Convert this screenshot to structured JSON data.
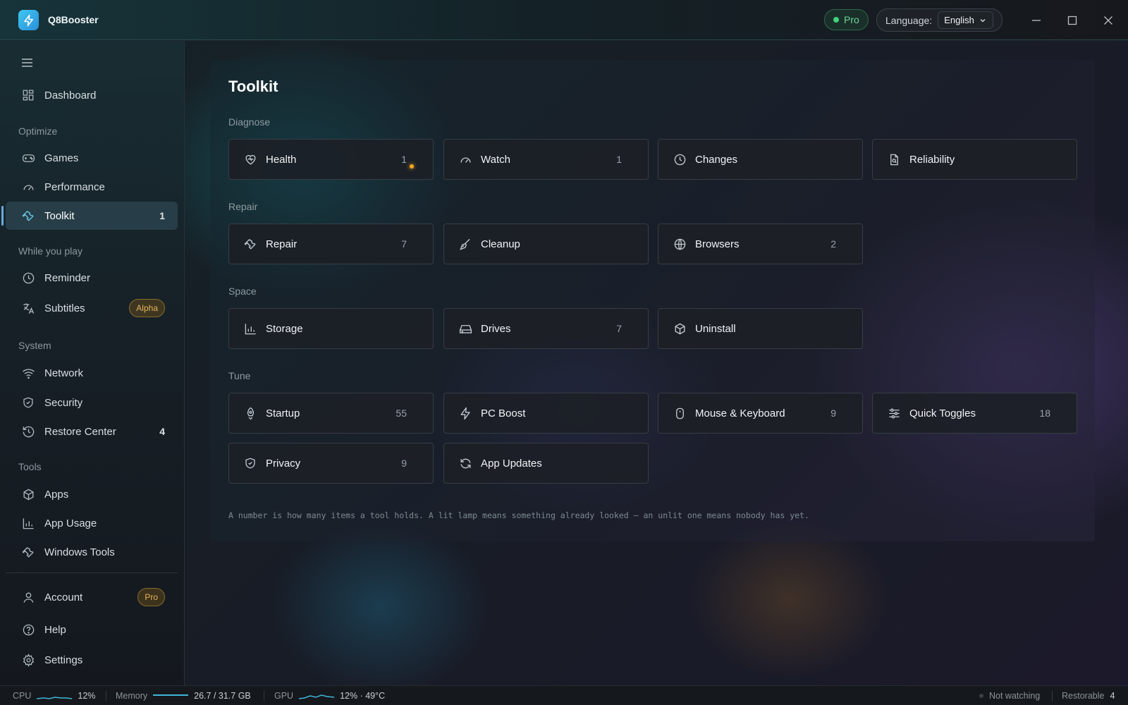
{
  "window": {
    "title": "Q8Booster",
    "pro_label": "Pro",
    "language_label": "Language:",
    "language_value": "English"
  },
  "sidebar": {
    "items": [
      {
        "label": "Dashboard",
        "icon": "dashboard-icon"
      },
      {
        "label": "Games",
        "icon": "gamepad-icon"
      },
      {
        "label": "Performance",
        "icon": "gauge-icon"
      },
      {
        "label": "Toolkit",
        "icon": "wrench-icon",
        "count": "1",
        "active": true
      },
      {
        "label": "Reminder",
        "icon": "clock-icon"
      },
      {
        "label": "Subtitles",
        "icon": "translate-icon",
        "badge": "Alpha"
      },
      {
        "label": "Network",
        "icon": "wifi-icon"
      },
      {
        "label": "Security",
        "icon": "shield-icon"
      },
      {
        "label": "Restore Center",
        "icon": "history-icon",
        "count": "4"
      },
      {
        "label": "Apps",
        "icon": "package-icon"
      },
      {
        "label": "App Usage",
        "icon": "bar-chart-icon"
      },
      {
        "label": "Windows Tools",
        "icon": "wrench-icon"
      },
      {
        "label": "Account",
        "icon": "user-icon",
        "badge": "Pro"
      },
      {
        "label": "Help",
        "icon": "help-icon"
      },
      {
        "label": "Settings",
        "icon": "gear-icon"
      }
    ],
    "sections": {
      "optimize": "Optimize",
      "while_you_play": "While you play",
      "system": "System",
      "tools": "Tools"
    }
  },
  "main": {
    "title": "Toolkit",
    "groups": {
      "diagnose": {
        "label": "Diagnose",
        "cards": [
          {
            "label": "Health",
            "count": "1",
            "lamp": true
          },
          {
            "label": "Watch",
            "count": "1"
          },
          {
            "label": "Changes",
            "count": ""
          },
          {
            "label": "Reliability",
            "count": ""
          }
        ]
      },
      "repair": {
        "label": "Repair",
        "cards": [
          {
            "label": "Repair",
            "count": "7"
          },
          {
            "label": "Cleanup",
            "count": ""
          },
          {
            "label": "Browsers",
            "count": "2"
          }
        ]
      },
      "space": {
        "label": "Space",
        "cards": [
          {
            "label": "Storage",
            "count": ""
          },
          {
            "label": "Drives",
            "count": "7"
          },
          {
            "label": "Uninstall",
            "count": ""
          }
        ]
      },
      "tune": {
        "label": "Tune",
        "cards": [
          {
            "label": "Startup",
            "count": "55"
          },
          {
            "label": "PC Boost",
            "count": ""
          },
          {
            "label": "Mouse & Keyboard",
            "count": "9"
          },
          {
            "label": "Quick Toggles",
            "count": "18"
          },
          {
            "label": "Privacy",
            "count": "9"
          },
          {
            "label": "App Updates",
            "count": ""
          }
        ]
      }
    },
    "footnote": "A number is how many items a tool holds. A lit lamp means something already looked — an unlit one means nobody has yet."
  },
  "statusbar": {
    "cpu_label": "CPU",
    "cpu_value": "12%",
    "memory_label": "Memory",
    "memory_value": "26.7 / 31.7 GB",
    "gpu_label": "GPU",
    "gpu_value": "12% · 49°C",
    "watch_status": "Not watching",
    "restorable_label": "Restorable",
    "restorable_value": "4"
  },
  "colors": {
    "accent": "#6cc6e6",
    "lamp": "#f2a623",
    "pro_green": "#3fd27d",
    "badge_amber": "#e2b45c"
  }
}
